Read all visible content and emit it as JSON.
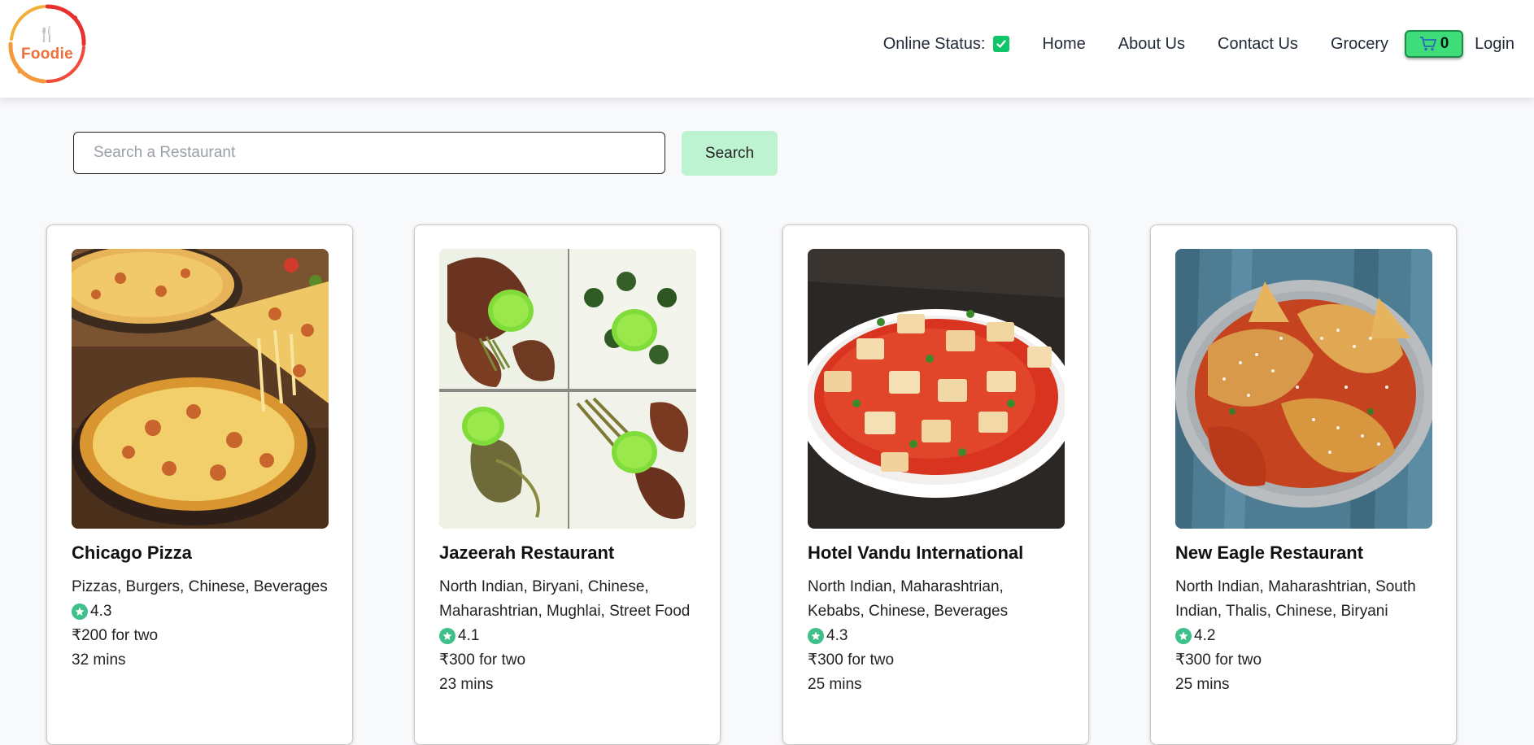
{
  "header": {
    "logo_text": "Foodie",
    "online_status_label": "Online Status:",
    "online_checked": true,
    "nav": [
      {
        "label": "Home"
      },
      {
        "label": "About Us"
      },
      {
        "label": "Contact Us"
      },
      {
        "label": "Grocery"
      }
    ],
    "cart_count": "0",
    "login_label": "Login"
  },
  "search": {
    "placeholder": "Search a Restaurant",
    "button_label": "Search"
  },
  "restaurants": [
    {
      "name": "Chicago Pizza",
      "cuisines": "Pizzas, Burgers, Chinese, Beverages",
      "rating": "4.3",
      "cost": "₹200 for two",
      "eta": "32 mins",
      "image": "pizza"
    },
    {
      "name": "Jazeerah Restaurant",
      "cuisines": "North Indian, Biryani, Chinese, Maharashtrian, Mughlai, Street Food",
      "rating": "4.1",
      "cost": "₹300 for two",
      "eta": "23 mins",
      "image": "grill-platter"
    },
    {
      "name": "Hotel Vandu International",
      "cuisines": "North Indian, Maharashtrian, Kebabs, Chinese, Beverages",
      "rating": "4.3",
      "cost": "₹300 for two",
      "eta": "25 mins",
      "image": "paneer-curry"
    },
    {
      "name": "New Eagle Restaurant",
      "cuisines": "North Indian, Maharashtrian, South Indian, Thalis, Chinese, Biryani",
      "rating": "4.2",
      "cost": "₹300 for two",
      "eta": "25 mins",
      "image": "stuffed-dish"
    }
  ],
  "colors": {
    "accent_green": "#3fdc7a",
    "rating_green": "#3fbf8a",
    "search_button": "#bdf3d1",
    "logo_orange": "#ef6f3a"
  }
}
